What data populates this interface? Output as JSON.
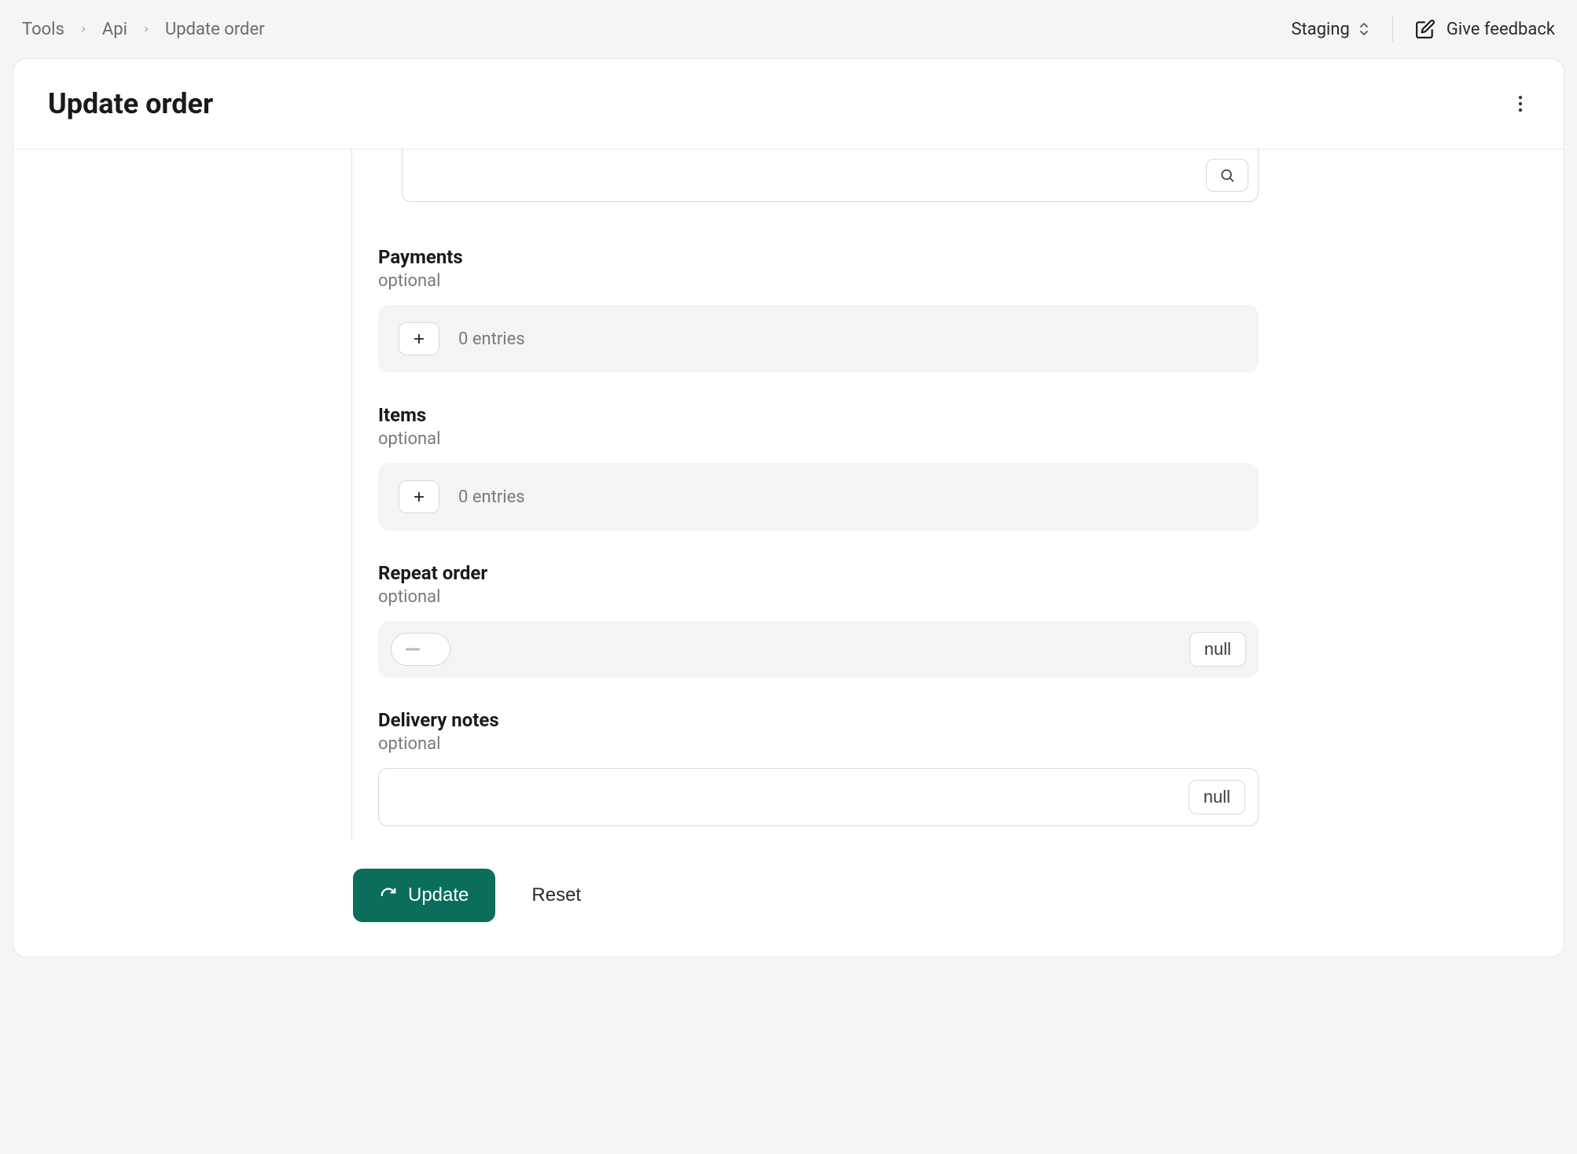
{
  "breadcrumb": {
    "items": [
      "Tools",
      "Api",
      "Update order"
    ]
  },
  "topbar": {
    "environment": "Staging",
    "feedback_label": "Give feedback"
  },
  "page": {
    "title": "Update order"
  },
  "fields": {
    "payments": {
      "label": "Payments",
      "sub": "optional",
      "entries_text": "0 entries"
    },
    "items": {
      "label": "Items",
      "sub": "optional",
      "entries_text": "0 entries"
    },
    "repeat_order": {
      "label": "Repeat order",
      "sub": "optional",
      "null_label": "null"
    },
    "delivery_notes": {
      "label": "Delivery notes",
      "sub": "optional",
      "value": "",
      "null_label": "null"
    }
  },
  "actions": {
    "update_label": "Update",
    "reset_label": "Reset"
  }
}
